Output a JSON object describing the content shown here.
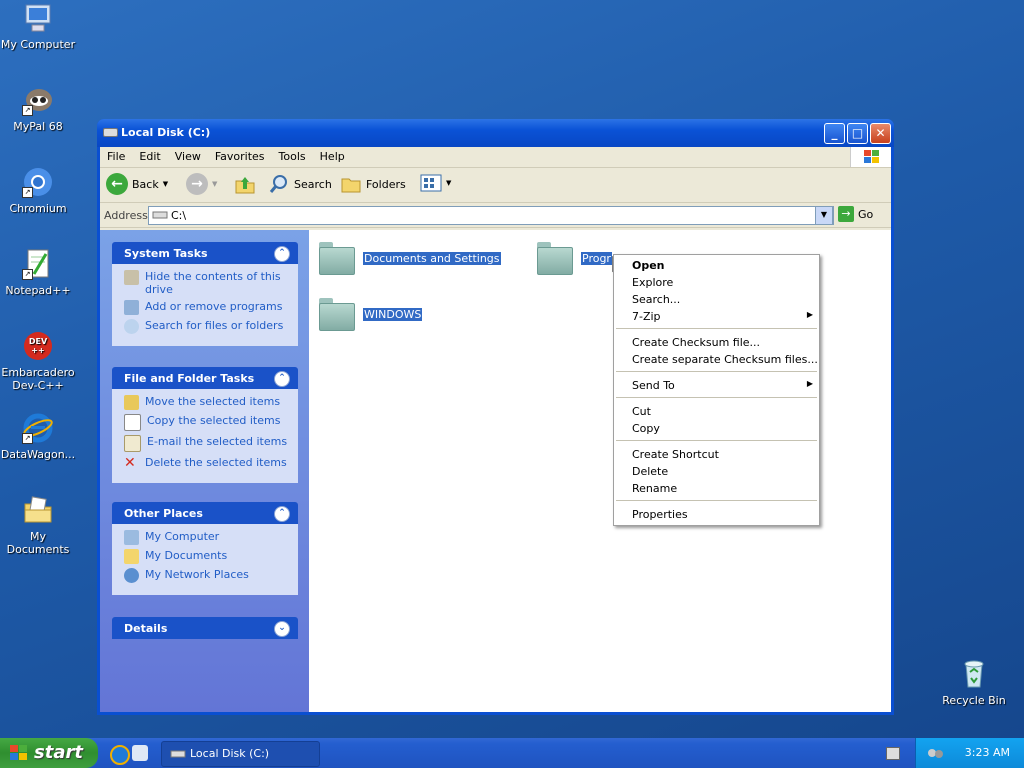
{
  "desktop": {
    "icons": [
      {
        "label": "My Computer"
      },
      {
        "label": "MyPal 68"
      },
      {
        "label": "Chromium"
      },
      {
        "label": "Notepad++"
      },
      {
        "label": "Embarcadero Dev-C++"
      },
      {
        "label": "DataWagon..."
      },
      {
        "label": "My Documents"
      },
      {
        "label": "Recycle Bin"
      }
    ],
    "devc_icon_text": "DEV\n++"
  },
  "window": {
    "title": "Local Disk (C:)",
    "menu": [
      "File",
      "Edit",
      "View",
      "Favorites",
      "Tools",
      "Help"
    ],
    "toolbar": {
      "back": "Back",
      "search": "Search",
      "folders": "Folders"
    },
    "address": {
      "label": "Address",
      "value": "C:\\",
      "go": "Go"
    },
    "panels": {
      "system_tasks": {
        "title": "System Tasks",
        "items": [
          "Hide the contents of this drive",
          "Add or remove programs",
          "Search for files or folders"
        ]
      },
      "file_folder_tasks": {
        "title": "File and Folder Tasks",
        "items": [
          "Move the selected items",
          "Copy the selected items",
          "E-mail the selected items",
          "Delete the selected items"
        ]
      },
      "other_places": {
        "title": "Other Places",
        "items": [
          "My Computer",
          "My Documents",
          "My Network Places"
        ]
      },
      "details": {
        "title": "Details"
      }
    },
    "folders": [
      "Documents and Settings",
      "Progr",
      "WINDOWS"
    ]
  },
  "context_menu": {
    "items": [
      {
        "label": "Open",
        "bold": true
      },
      {
        "label": "Explore"
      },
      {
        "label": "Search..."
      },
      {
        "label": "7-Zip",
        "submenu": true
      },
      {
        "label": "Create Checksum file..."
      },
      {
        "label": "Create separate Checksum files..."
      },
      {
        "label": "Send To",
        "submenu": true
      },
      {
        "label": "Cut"
      },
      {
        "label": "Copy"
      },
      {
        "label": "Create Shortcut"
      },
      {
        "label": "Delete"
      },
      {
        "label": "Rename"
      },
      {
        "label": "Properties"
      }
    ]
  },
  "taskbar": {
    "start": "start",
    "window_button": "Local Disk (C:)",
    "clock": "3:23 AM"
  },
  "colors": {
    "selection": "#316ac5",
    "taskpane_link": "#215dc6",
    "title_blue": "#0a52d6"
  }
}
